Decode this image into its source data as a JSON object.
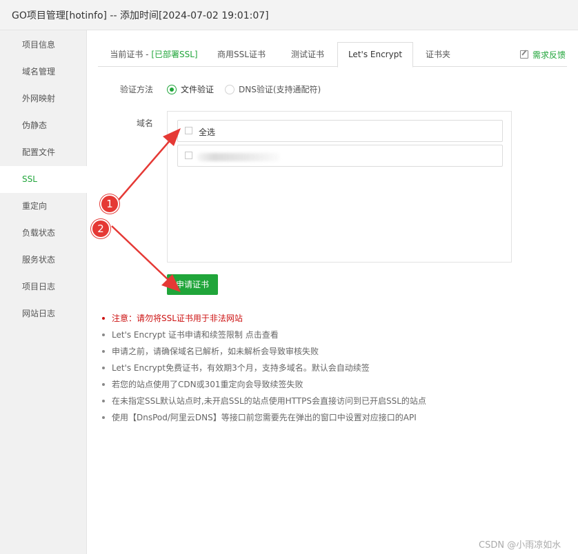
{
  "window": {
    "title": "GO项目管理[hotinfo] -- 添加时间[2024-07-02 19:01:07]"
  },
  "sidebar": {
    "items": [
      {
        "label": "项目信息"
      },
      {
        "label": "域名管理"
      },
      {
        "label": "外网映射"
      },
      {
        "label": "伪静态"
      },
      {
        "label": "配置文件"
      },
      {
        "label": "SSL",
        "active": true
      },
      {
        "label": "重定向"
      },
      {
        "label": "负载状态"
      },
      {
        "label": "服务状态"
      },
      {
        "label": "项目日志"
      },
      {
        "label": "网站日志"
      }
    ]
  },
  "tabs": {
    "current_prefix": "当前证书 - ",
    "current_status": "[已部署SSL]",
    "commercial": "商用SSL证书",
    "test": "测试证书",
    "letsencrypt": "Let's Encrypt",
    "folder": "证书夹",
    "feedback": "需求反馈"
  },
  "form": {
    "verify_label": "验证方法",
    "verify_file": "文件验证",
    "verify_dns": "DNS验证(支持通配符)",
    "selected_method": "文件验证",
    "domain_label": "域名",
    "select_all": "全选",
    "apply_button": "申请证书"
  },
  "notes": [
    "注意：请勿将SSL证书用于非法网站",
    "Let's Encrypt 证书申请和续签限制 点击查看",
    "申请之前，请确保域名已解析，如未解析会导致审核失败",
    "Let's Encrypt免费证书，有效期3个月，支持多域名。默认会自动续签",
    "若您的站点使用了CDN或301重定向会导致续签失败",
    "在未指定SSL默认站点时,未开启SSL的站点使用HTTPS会直接访问到已开启SSL的站点",
    "使用【DnsPod/阿里云DNS】等接口前您需要先在弹出的窗口中设置对应接口的API"
  ],
  "annotations": {
    "badge1": "1",
    "badge2": "2"
  },
  "watermark": "CSDN @小雨凉如水",
  "colors": {
    "accent": "#20a53a",
    "warning": "#cc1111",
    "annotation": "#e53935"
  }
}
